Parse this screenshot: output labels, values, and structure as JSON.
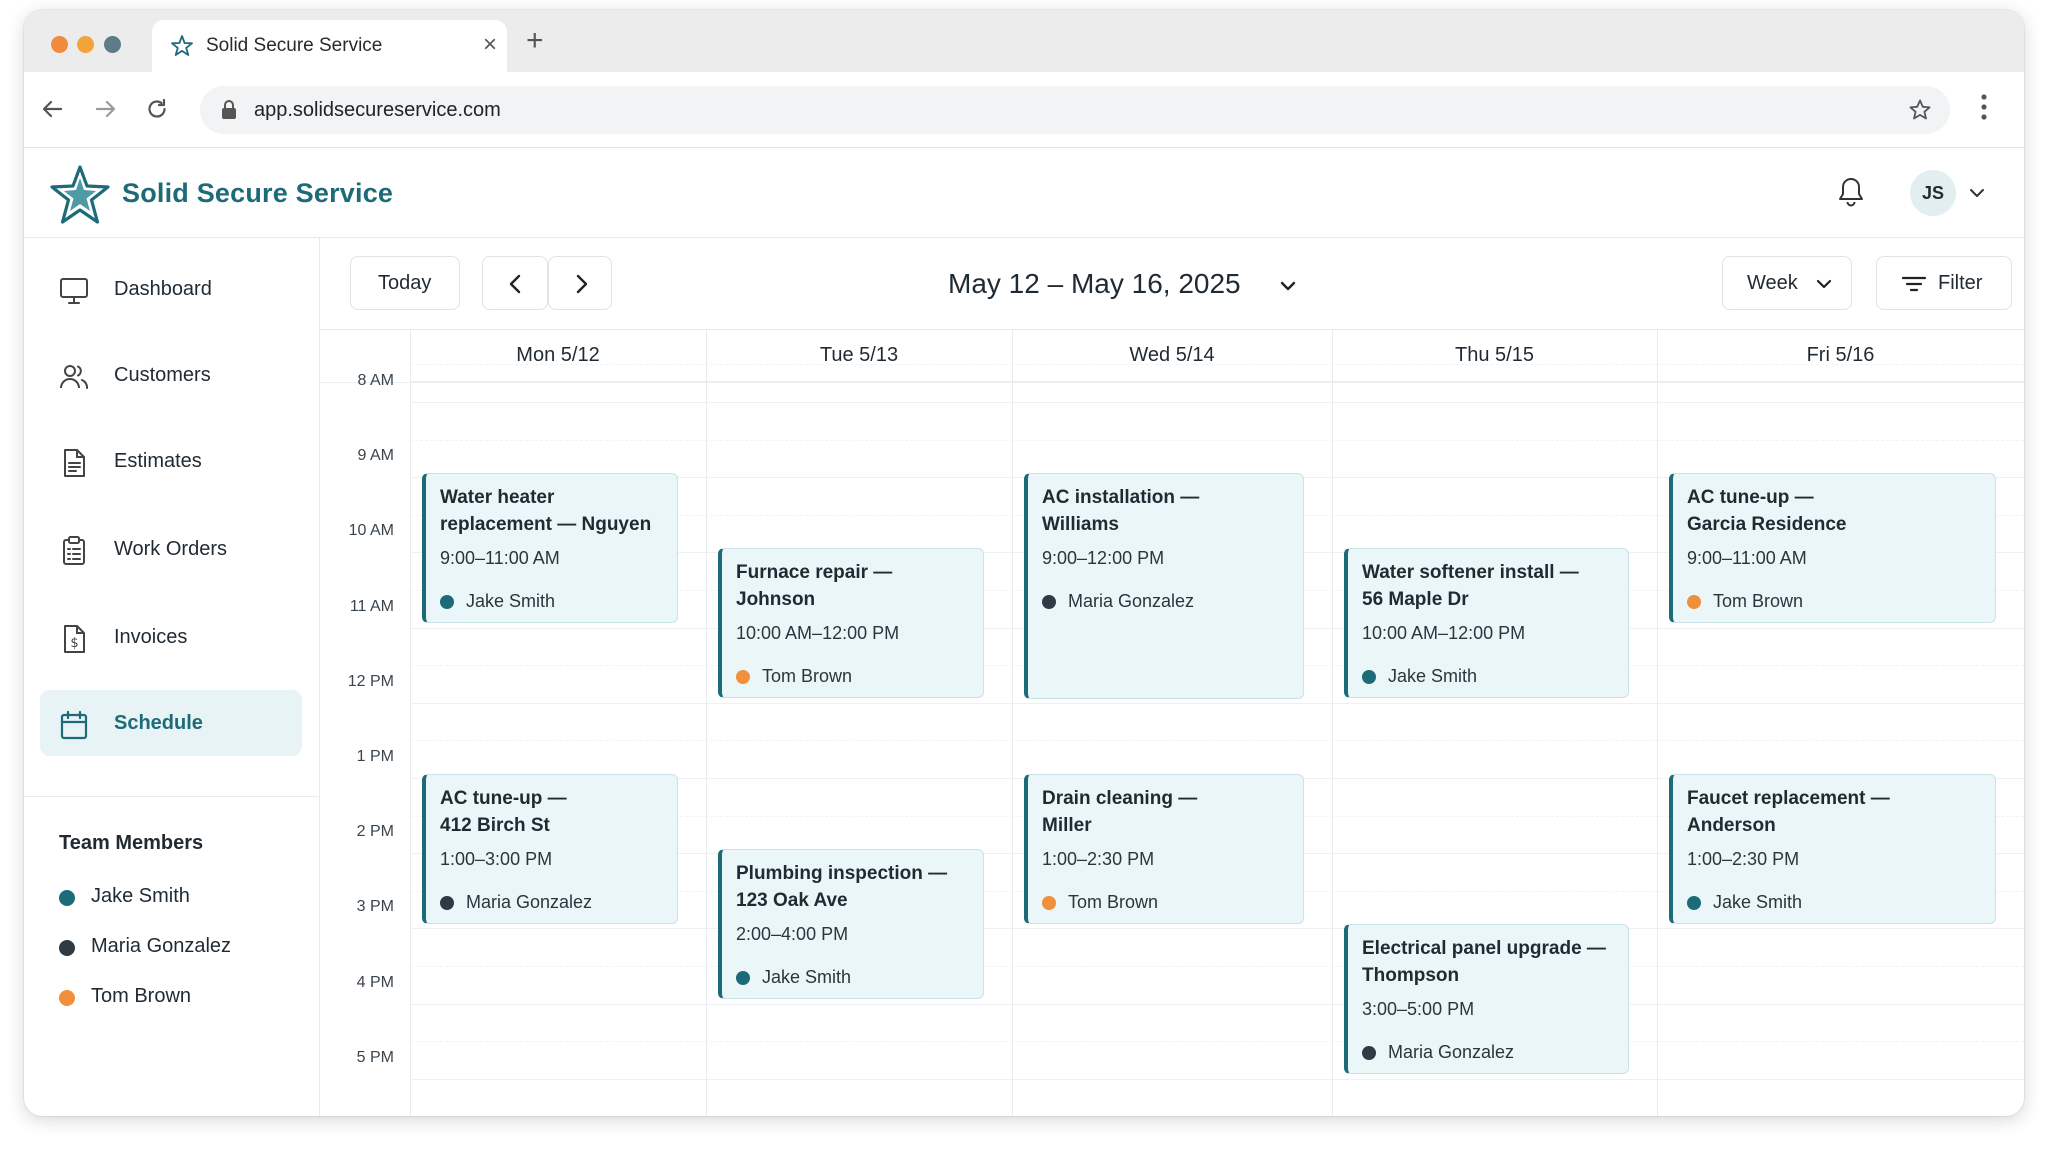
{
  "browser": {
    "tab_title": "Solid Secure Service",
    "tab_close": "×",
    "new_tab": "+",
    "url": "app.solidsecureservice.com"
  },
  "app": {
    "brand": "Solid Secure Service",
    "user_initials": "JS"
  },
  "sidebar": {
    "items": [
      {
        "label": "Dashboard",
        "icon": "monitor-icon"
      },
      {
        "label": "Customers",
        "icon": "users-icon"
      },
      {
        "label": "Estimates",
        "icon": "document-icon"
      },
      {
        "label": "Work Orders",
        "icon": "clipboard-icon"
      },
      {
        "label": "Invoices",
        "icon": "invoice-icon"
      },
      {
        "label": "Schedule",
        "icon": "calendar-icon",
        "active": true
      }
    ],
    "team_title": "Team Members",
    "team": [
      {
        "name": "Jake Smith",
        "color": "#1d6b78"
      },
      {
        "name": "Maria Gonzalez",
        "color": "#2e3a44"
      },
      {
        "name": "Tom Brown",
        "color": "#f0903a"
      }
    ]
  },
  "toolbar": {
    "today": "Today",
    "range": "May 12 – May 16, 2025",
    "view": "Week",
    "filter": "Filter"
  },
  "calendar": {
    "days": [
      "Mon 5/12",
      "Tue 5/13",
      "Wed 5/14",
      "Thu 5/15",
      "Fri 5/16"
    ],
    "hours": [
      "8 AM",
      "9 AM",
      "10 AM",
      "11 AM",
      "12 PM",
      "1 PM",
      "2 PM",
      "3 PM",
      "4 PM",
      "5 PM"
    ],
    "events": [
      {
        "day": 0,
        "start": 9,
        "end": 11,
        "title_lines": [
          "Water heater",
          "replacement — Nguyen"
        ],
        "time": "9:00–11:00 AM",
        "tech": "Jake Smith"
      },
      {
        "day": 0,
        "start": 13,
        "end": 15,
        "title_lines": [
          "AC tune-up —",
          "412 Birch St"
        ],
        "time": "1:00–3:00 PM",
        "tech": "Maria Gonzalez"
      },
      {
        "day": 1,
        "start": 10,
        "end": 12,
        "title_lines": [
          "Furnace repair —",
          "Johnson"
        ],
        "time": "10:00 AM–12:00 PM",
        "tech": "Tom Brown"
      },
      {
        "day": 1,
        "start": 14,
        "end": 16,
        "title_lines": [
          "Plumbing inspection —",
          "123 Oak Ave"
        ],
        "time": "2:00–4:00 PM",
        "tech": "Jake Smith"
      },
      {
        "day": 2,
        "start": 9,
        "end": 12,
        "title_lines": [
          "AC installation —",
          "Williams"
        ],
        "time": "9:00–12:00 PM",
        "tech": "Maria Gonzalez"
      },
      {
        "day": 2,
        "start": 13,
        "end": 15,
        "title_lines": [
          "Drain cleaning —",
          "Miller"
        ],
        "time": "1:00–2:30 PM",
        "tech": "Tom Brown"
      },
      {
        "day": 3,
        "start": 10,
        "end": 12,
        "title_lines": [
          "Water softener install —",
          "56 Maple Dr"
        ],
        "time": "10:00 AM–12:00 PM",
        "tech": "Jake Smith"
      },
      {
        "day": 3,
        "start": 15,
        "end": 17,
        "title_lines": [
          "Electrical panel upgrade —",
          "Thompson"
        ],
        "time": "3:00–5:00 PM",
        "tech": "Maria Gonzalez"
      },
      {
        "day": 4,
        "start": 9,
        "end": 11,
        "title_lines": [
          "AC tune-up —",
          "Garcia Residence"
        ],
        "time": "9:00–11:00 AM",
        "tech": "Tom Brown"
      },
      {
        "day": 4,
        "start": 13,
        "end": 15,
        "title_lines": [
          "Faucet replacement —",
          "Anderson"
        ],
        "time": "1:00–2:30 PM",
        "tech": "Jake Smith"
      }
    ]
  }
}
